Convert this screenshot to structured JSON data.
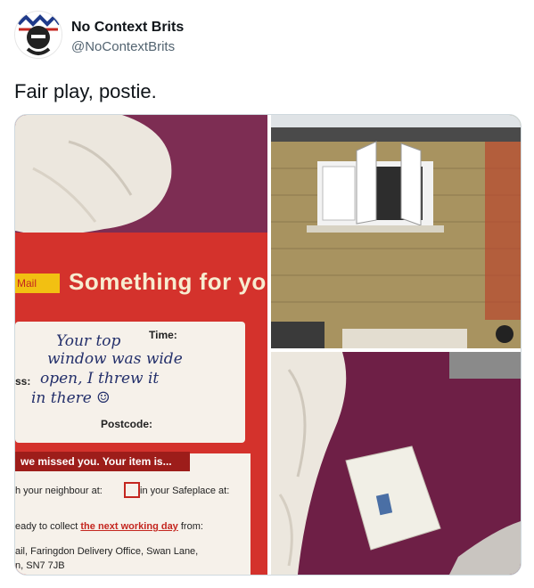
{
  "author": {
    "display_name": "No Context Brits",
    "handle": "@NoContextBrits"
  },
  "tweet": {
    "text": "Fair play, postie."
  },
  "photo_left": {
    "card_brand": "Mail",
    "card_title": "Something for yo",
    "time_label": "Time:",
    "address_label": "ss:",
    "postcode_label": "Postcode:",
    "handwriting": [
      "Your top",
      "window was wide",
      "open, I threw it",
      "in there ☺"
    ],
    "banner": "we missed you. Your item is...",
    "option_neighbour": "h your neighbour at:",
    "option_safeplace": "in your Safeplace at:",
    "collect_prefix": "eady to collect",
    "collect_link": "the next working day",
    "collect_suffix": "from:",
    "office_line1": "ail, Faringdon Delivery Office, Swan Lane,",
    "office_line2": "n, SN7 7JB"
  },
  "colors": {
    "accent": "#d4322c",
    "duvet": "#7d2d53",
    "brick": "#a89360"
  }
}
